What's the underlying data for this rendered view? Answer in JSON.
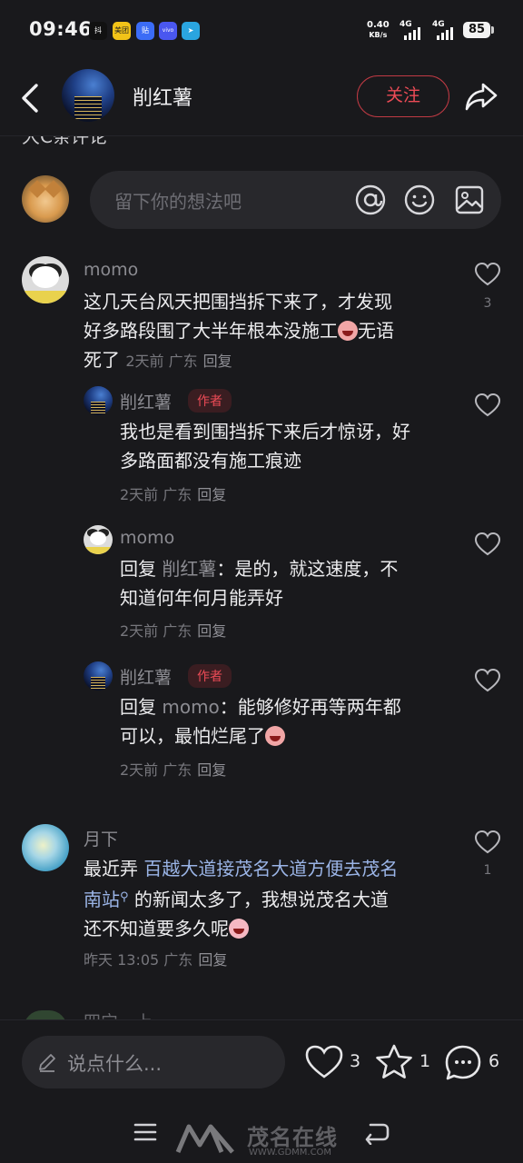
{
  "status_bar": {
    "time": "09:46",
    "apps": [
      {
        "name": "douyin",
        "label": "抖",
        "color": "#111111"
      },
      {
        "name": "meituan",
        "label": "美团",
        "color": "#f2c318"
      },
      {
        "name": "tieba",
        "label": "贴",
        "color": "#3b6cf6"
      },
      {
        "name": "vivo",
        "label": "vivo",
        "color": "#4a57f0"
      },
      {
        "name": "telegram",
        "label": "➤",
        "color": "#2aa5e0"
      }
    ],
    "net_speed": "0.40",
    "net_unit": "KB/s",
    "signal1": "4G",
    "signal2": "4G",
    "battery": "85"
  },
  "header": {
    "name": "削红薯",
    "follow": "关注"
  },
  "partial_text": "大C条评论",
  "input": {
    "placeholder": "留下你的想法吧"
  },
  "comments": [
    {
      "user": "momo",
      "text": "这几天台风天把围挡拆下来了，才发现好多路段围了大半年根本没施工",
      "text_line1": "这几天台风天把围挡拆下来了，才发现",
      "text_line2": "好多路段围了大半年根本没施工",
      "text_tail_word": "无语",
      "text_line3": "死了",
      "time": "2天前",
      "location": "广东",
      "reply_label": "回复",
      "likes": "3",
      "replies": [
        {
          "user": "削红薯",
          "tag": "作者",
          "text_line1": "我也是看到围挡拆下来后才惊讶，好",
          "text_line2": "多路面都没有施工痕迹",
          "time": "2天前",
          "location": "广东",
          "reply_label": "回复"
        },
        {
          "user": "momo",
          "reply_prefix": "回复",
          "reply_to": "削红薯",
          "text_line1_tail": "：是的，就这速度，不",
          "text_line2": "知道何年何月能弄好",
          "time": "2天前",
          "location": "广东",
          "reply_label": "回复"
        },
        {
          "user": "削红薯",
          "tag": "作者",
          "reply_prefix": "回复",
          "reply_to": "momo",
          "text_line1_tail": "：能够修好再等两年都",
          "text_line2": "可以，最怕烂尾了",
          "time": "2天前",
          "location": "广东",
          "reply_label": "回复"
        }
      ]
    },
    {
      "user": "月下",
      "text_line1_head": "最近弄",
      "text_line1_link": "百越大道接茂名大道方便去茂名",
      "text_line2_link": "南站",
      "text_line2_tail": "的新闻太多了，我想说茂名大道",
      "text_line3": "还不知道要多久呢",
      "time": "昨天 13:05",
      "location": "广东",
      "reply_label": "回复",
      "likes": "1"
    }
  ],
  "partial_next_user": "四宁…上",
  "bottom_bar": {
    "say_placeholder": "说点什么...",
    "likes": "3",
    "favorites": "1",
    "comments": "6"
  },
  "watermark": {
    "site": "WWW.GDMM.COM",
    "brand": "茂名在线"
  },
  "colors": {
    "background": "#19191c",
    "accent_red": "#ec4b56",
    "input_bg": "#28282c"
  }
}
